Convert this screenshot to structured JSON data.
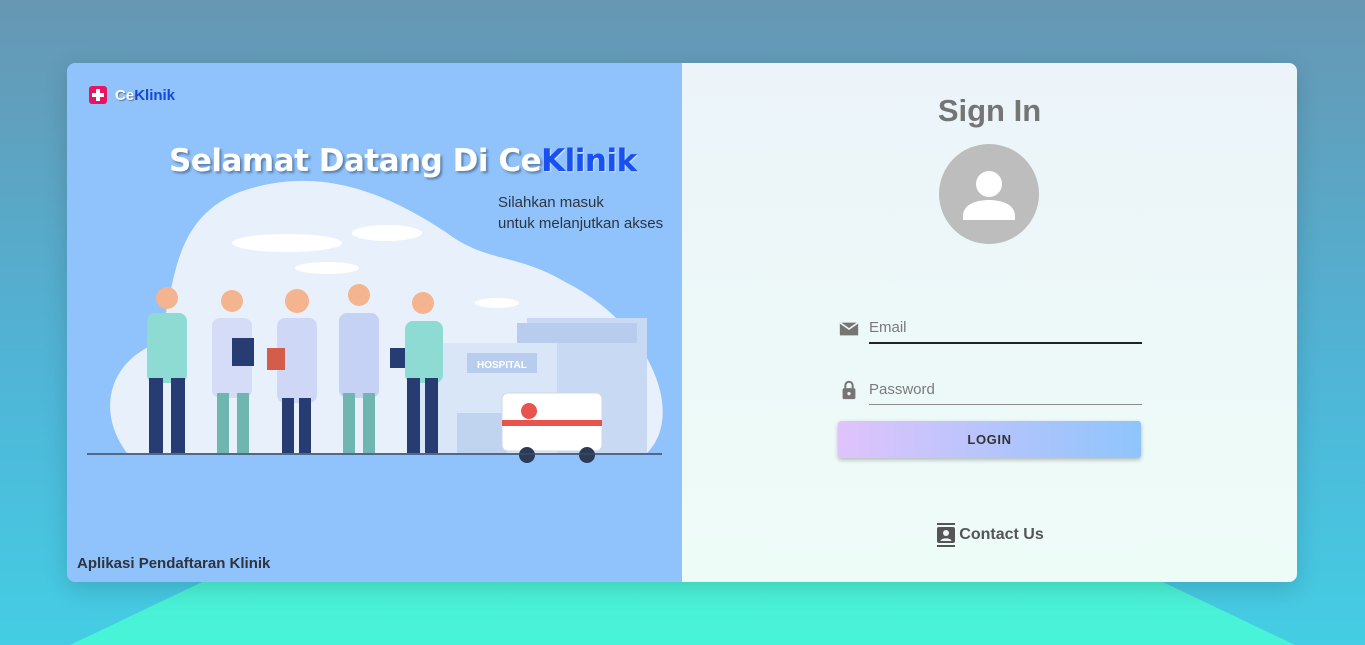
{
  "brand": {
    "part1": "Ce",
    "part2": "Klinik",
    "accent": "#e6155f"
  },
  "left": {
    "welcome_part1": "Selamat Datang Di Ce",
    "welcome_part2": "Klinik",
    "subtitle_line1": "Silahkan masuk",
    "subtitle_line2": "untuk melanjutkan akses",
    "hospital_sign": "HOSPITAL",
    "footer": "Aplikasi Pendaftaran Klinik"
  },
  "signin": {
    "title": "Sign In",
    "email_placeholder": "Email",
    "password_placeholder": "Password",
    "login_label": "LOGIN",
    "contact_label": "Contact Us"
  },
  "icons": {
    "brand": "medical-cross-icon",
    "avatar": "user-avatar-icon",
    "email": "mail-icon",
    "password": "lock-icon",
    "contact": "contact-card-icon"
  }
}
